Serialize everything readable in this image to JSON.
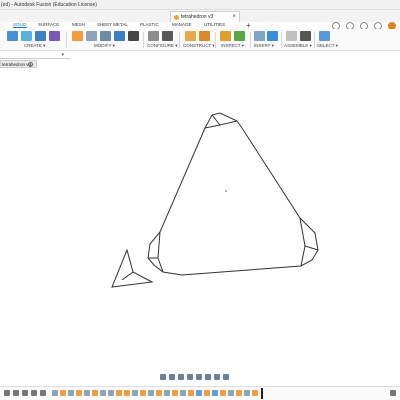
{
  "window": {
    "title": "(ed) - Autodesk Fusion (Education License)"
  },
  "document_tab": {
    "label": "tetrahedron v3"
  },
  "workspace_tabs": [
    "SOLID",
    "SURFACE",
    "MESH",
    "SHEET METAL",
    "PLASTIC",
    "MANAGE",
    "UTILITIES"
  ],
  "toolbar": {
    "groups": [
      "CREATE ▾",
      "MODIFY ▾",
      "CONFIGURE ▾",
      "CONSTRUCT ▾",
      "INSPECT ▾",
      "INSERT ▾",
      "ASSEMBLE ▾",
      "SELECT ▾"
    ]
  },
  "sheet_tab": {
    "label": "tetrahedron v3"
  },
  "colors": {
    "accent": "#1a73d6",
    "toolbar_orange": "#f39c3c",
    "nav_icon": "#6b7f96"
  }
}
